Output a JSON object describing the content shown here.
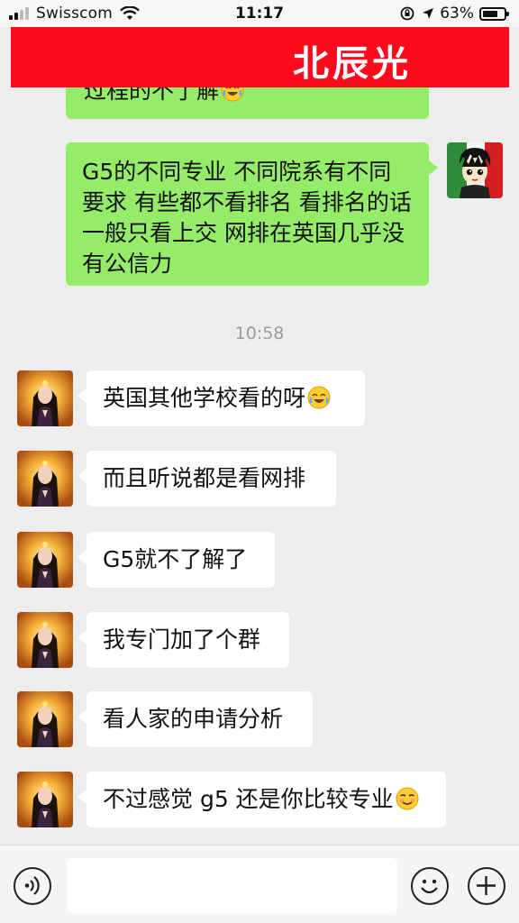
{
  "status_bar": {
    "carrier": "Swisscom",
    "time": "11:17",
    "battery_percent": "63%",
    "battery_level": 0.63
  },
  "header": {
    "title": "北辰光",
    "background_color": "#ff0a1c"
  },
  "chat": {
    "partial_message": "过程的不了解",
    "my_message": "G5的不同专业 不同院系有不同要求 有些都不看排名  看排名的话 一般只看上交  网排在英国几乎没有公信力",
    "timestamp": "10:58",
    "other_messages": [
      "英国其他学校看的呀",
      "而且听说都是看网排",
      "G5就不了解了",
      "我专门加了个群",
      "看人家的申请分析",
      "不过感觉 g5 还是你比较专业"
    ]
  },
  "colors": {
    "my_bubble": "#95ec69",
    "other_bubble": "#ffffff",
    "chat_background": "#ededed"
  },
  "icons": {
    "voice": "voice-icon",
    "emoji": "emoji-icon",
    "add": "add-icon",
    "crying_laughing": "crying-laughing-emoji",
    "smirk": "smirk-emoji"
  }
}
